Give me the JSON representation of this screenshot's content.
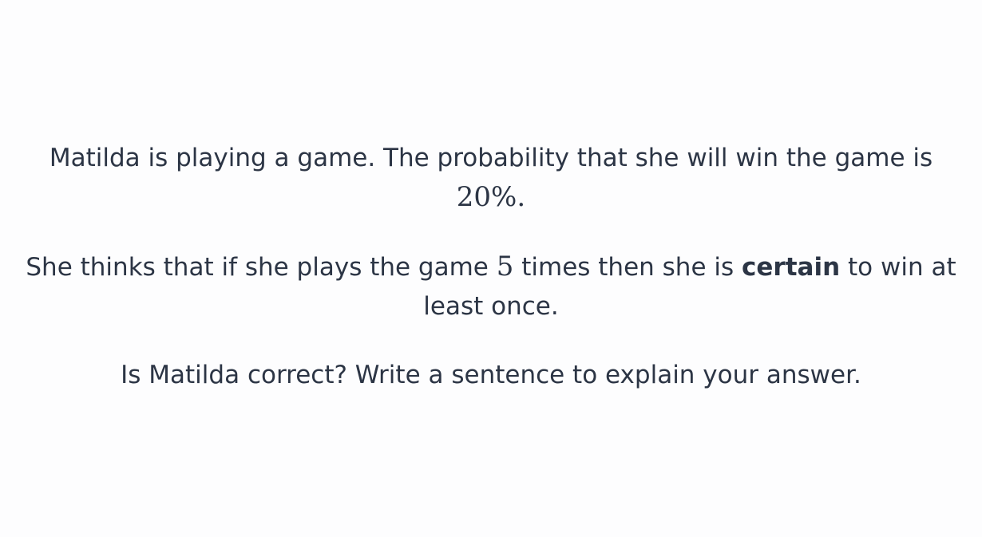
{
  "question": {
    "para1": {
      "text_a": "Matilda is playing a game. The probability that she will win the game is",
      "value": "20%",
      "text_b": "."
    },
    "para2": {
      "text_a": "She thinks that if she plays the game",
      "count": "5",
      "text_b": "times then she is",
      "emphasis": "certain",
      "text_c": "to win at least once."
    },
    "para3": {
      "text": "Is Matilda correct? Write a sentence to explain your answer."
    }
  }
}
